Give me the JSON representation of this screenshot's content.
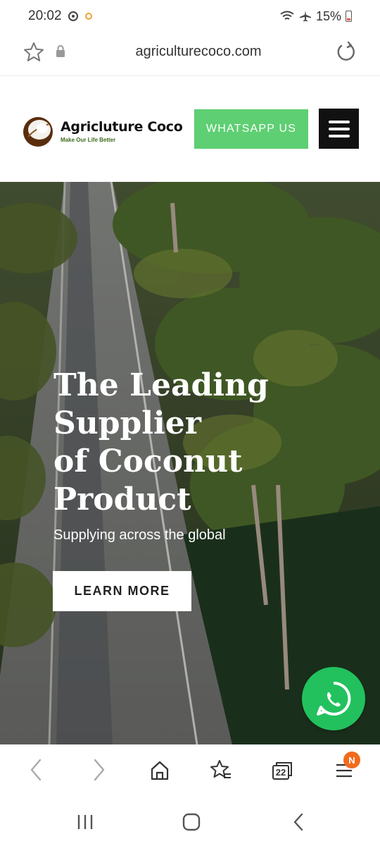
{
  "status_bar": {
    "time": "20:02",
    "battery": "15%"
  },
  "address_bar": {
    "url": "agriculturecoco.com"
  },
  "site_header": {
    "logo_name": "Agricluture Coco",
    "logo_tagline": "Make Our Life Better",
    "whatsapp_label": "WHATSAPP US"
  },
  "hero": {
    "title_lines": [
      "The Leading",
      "Supplier",
      "of Coconut",
      "Product"
    ],
    "subtitle": "Supplying across the global",
    "cta_label": "LEARN MORE"
  },
  "browser_toolbar": {
    "tab_count": "22",
    "notification_badge": "N"
  },
  "colors": {
    "whatsapp_green": "#5ecf72",
    "whatsapp_float": "#22c15e",
    "menu_black": "#111111",
    "badge_orange": "#f26b1d"
  },
  "icons": [
    "star-icon",
    "lock-icon",
    "reload-icon",
    "menu-icon",
    "whatsapp-icon",
    "back-icon",
    "forward-icon",
    "home-icon",
    "bookmarks-icon",
    "tabs-icon",
    "browser-menu-icon",
    "recents-icon",
    "home-nav-icon",
    "back-nav-icon"
  ]
}
